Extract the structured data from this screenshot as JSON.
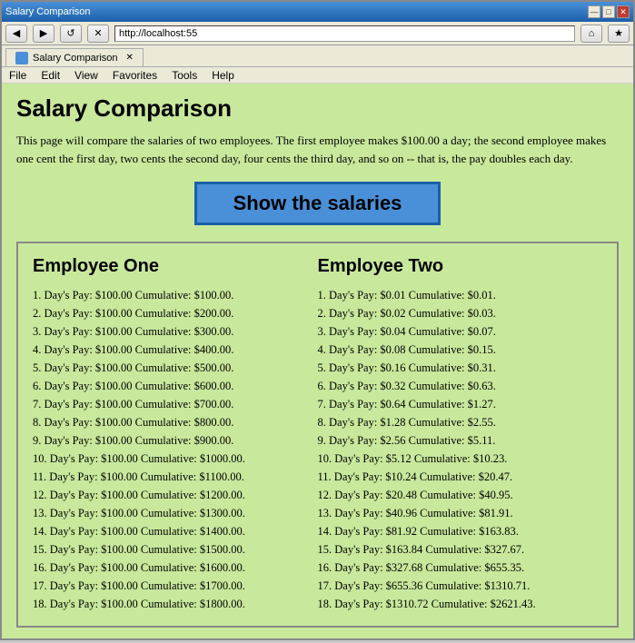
{
  "browser": {
    "title": "Salary Comparison",
    "address": "http://localhost:55",
    "tab_label": "Salary Comparison",
    "minimize": "—",
    "maximize": "□",
    "close": "✕"
  },
  "menu": {
    "items": [
      "File",
      "Edit",
      "View",
      "Favorites",
      "Tools",
      "Help"
    ]
  },
  "page": {
    "title": "Salary Comparison",
    "description": "This page will compare the salaries of two employees. The first employee makes $100.00 a day; the second employee makes one cent the first day, two cents the second day, four cents the third day, and so on -- that is, the pay doubles each day.",
    "button_label": "Show the salaries"
  },
  "employee_one": {
    "header": "Employee One",
    "entries": [
      "1. Day's Pay: $100.00 Cumulative: $100.00.",
      "2. Day's Pay: $100.00 Cumulative: $200.00.",
      "3. Day's Pay: $100.00 Cumulative: $300.00.",
      "4. Day's Pay: $100.00 Cumulative: $400.00.",
      "5. Day's Pay: $100.00 Cumulative: $500.00.",
      "6. Day's Pay: $100.00 Cumulative: $600.00.",
      "7. Day's Pay: $100.00 Cumulative: $700.00.",
      "8. Day's Pay: $100.00 Cumulative: $800.00.",
      "9. Day's Pay: $100.00 Cumulative: $900.00.",
      "10. Day's Pay: $100.00 Cumulative: $1000.00.",
      "11. Day's Pay: $100.00 Cumulative: $1100.00.",
      "12. Day's Pay: $100.00 Cumulative: $1200.00.",
      "13. Day's Pay: $100.00 Cumulative: $1300.00.",
      "14. Day's Pay: $100.00 Cumulative: $1400.00.",
      "15. Day's Pay: $100.00 Cumulative: $1500.00.",
      "16. Day's Pay: $100.00 Cumulative: $1600.00.",
      "17. Day's Pay: $100.00 Cumulative: $1700.00.",
      "18. Day's Pay: $100.00 Cumulative: $1800.00."
    ]
  },
  "employee_two": {
    "header": "Employee Two",
    "entries": [
      "1. Day's Pay: $0.01 Cumulative: $0.01.",
      "2. Day's Pay: $0.02 Cumulative: $0.03.",
      "3. Day's Pay: $0.04 Cumulative: $0.07.",
      "4. Day's Pay: $0.08 Cumulative: $0.15.",
      "5. Day's Pay: $0.16 Cumulative: $0.31.",
      "6. Day's Pay: $0.32 Cumulative: $0.63.",
      "7. Day's Pay: $0.64 Cumulative: $1.27.",
      "8. Day's Pay: $1.28 Cumulative: $2.55.",
      "9. Day's Pay: $2.56 Cumulative: $5.11.",
      "10. Day's Pay: $5.12 Cumulative: $10.23.",
      "11. Day's Pay: $10.24 Cumulative: $20.47.",
      "12. Day's Pay: $20.48 Cumulative: $40.95.",
      "13. Day's Pay: $40.96 Cumulative: $81.91.",
      "14. Day's Pay: $81.92 Cumulative: $163.83.",
      "15. Day's Pay: $163.84 Cumulative: $327.67.",
      "16. Day's Pay: $327.68 Cumulative: $655.35.",
      "17. Day's Pay: $655.36 Cumulative: $1310.71.",
      "18. Day's Pay: $1310.72 Cumulative: $2621.43."
    ]
  }
}
